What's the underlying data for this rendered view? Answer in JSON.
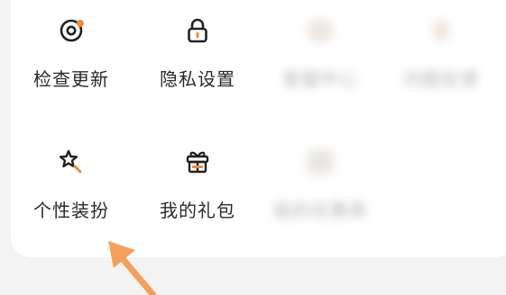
{
  "grid": {
    "row1": [
      {
        "label": "检查更新",
        "icon": "check-update-icon"
      },
      {
        "label": "隐私设置",
        "icon": "lock-icon"
      },
      {
        "label": "客服中心",
        "icon": "customer-service-icon"
      },
      {
        "label": "问题反馈",
        "icon": "feedback-icon"
      }
    ],
    "row2": [
      {
        "label": "个性装扮",
        "icon": "sparkle-wand-icon"
      },
      {
        "label": "我的礼包",
        "icon": "gift-icon"
      },
      {
        "label": "我的优惠券",
        "icon": "coupon-icon"
      }
    ]
  },
  "accent_color": "#f08a3c",
  "annotation": {
    "icon": "pointer-arrow-icon",
    "color": "#f5a05a"
  }
}
